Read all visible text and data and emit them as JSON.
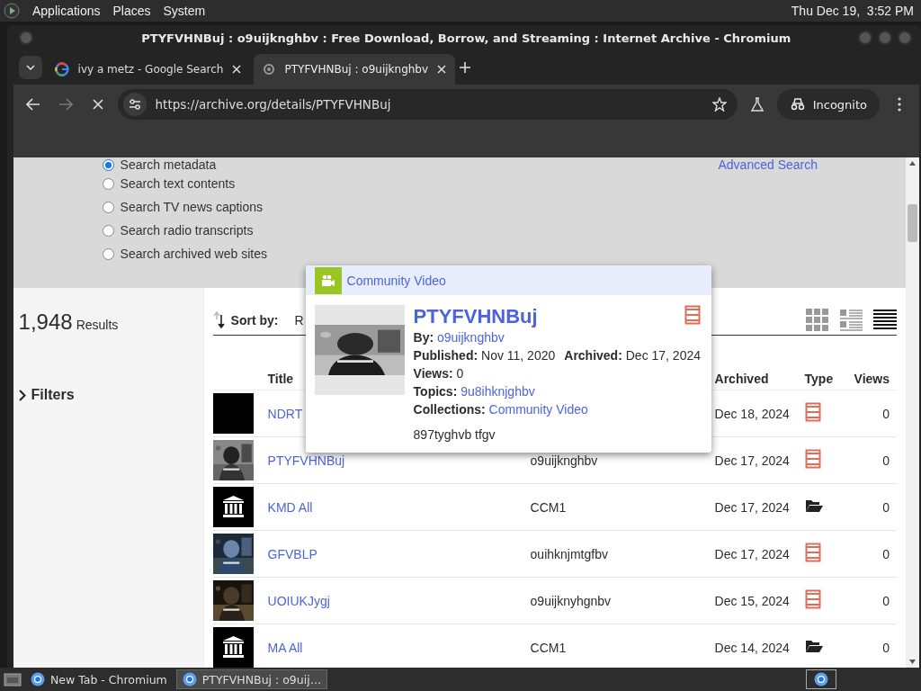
{
  "top_panel": {
    "menus": [
      "Applications",
      "Places",
      "System"
    ],
    "clock": "Thu Dec 19,  3:52 PM"
  },
  "window": {
    "title": "PTYFVHNBuj : o9uijknghbv : Free Download, Borrow, and Streaming : Internet Archive - Chromium"
  },
  "tabs": [
    {
      "label": "ivy a metz - Google Search",
      "selected": false
    },
    {
      "label": "PTYFVHNBuj : o9uijknghbv",
      "selected": true
    }
  ],
  "toolbar": {
    "forward_disabled": true,
    "url": "https://archive.org/details/PTYFVHNBuj",
    "profile": "Incognito"
  },
  "search_options": [
    {
      "label": "Search metadata",
      "selected": true
    },
    {
      "label": "Search text contents",
      "selected": false
    },
    {
      "label": "Search TV news captions",
      "selected": false
    },
    {
      "label": "Search radio transcripts",
      "selected": false
    },
    {
      "label": "Search archived web sites",
      "selected": false
    }
  ],
  "advanced_search": "Advanced Search",
  "results": {
    "count": "1,948",
    "label": "Results"
  },
  "filters": "Filters",
  "sort": {
    "label": "Sort by:",
    "value": "R"
  },
  "view_modes": [
    {
      "kind": "tiles",
      "selected": false
    },
    {
      "kind": "list",
      "selected": false
    },
    {
      "kind": "compact",
      "selected": true
    }
  ],
  "table": {
    "columns": [
      "Title",
      "Archived",
      "Type",
      "Views"
    ],
    "rows": [
      {
        "thumbnail": {
          "kind": "blank"
        },
        "title": "NDRT",
        "archived": "Dec 18, 2024",
        "kind": "movies",
        "views": "0"
      },
      {
        "title": "PTYFVHNBuj",
        "creator": "o9uijknghbv",
        "archived": "Dec 17, 2024",
        "kind": "movies",
        "views": "0"
      },
      {
        "thumbnail": {
          "kind": "collection"
        },
        "title": "KMD All",
        "creator": "CCM1",
        "archived": "Dec 17, 2024",
        "kind": "collection",
        "views": "0"
      },
      {
        "title": "GFVBLP",
        "creator": "ouihknjmtgfbv",
        "archived": "Dec 17, 2024",
        "kind": "movies",
        "views": "0"
      },
      {
        "title": "UOIUKJygj",
        "creator": "o9uijknyhgnbv",
        "archived": "Dec 15, 2024",
        "kind": "movies",
        "views": "0"
      },
      {
        "thumbnail": {
          "kind": "collection"
        },
        "title": "MA All",
        "creator": "CCM1",
        "archived": "Dec 14, 2024",
        "kind": "collection",
        "views": "0"
      }
    ]
  },
  "popup": {
    "collection": "Community Video",
    "title": "PTYFVHNBuj",
    "kind": "movies",
    "lines": [
      [
        {
          "label": "By:",
          "value": "o9uijknghbv",
          "link": true
        }
      ],
      [
        {
          "label": "Published:",
          "value": "Nov 11, 2020",
          "link": false
        },
        {
          "label": "Archived:",
          "value": "Dec 17, 2024",
          "link": false
        }
      ],
      [
        {
          "label": "Views:",
          "value": "0",
          "link": false
        }
      ],
      [
        {
          "label": "Topics:",
          "value": "9u8ihknjghbv",
          "link": true
        }
      ],
      [
        {
          "label": "Collections:",
          "value": "Community Video",
          "link": true
        }
      ]
    ],
    "description": "897tyghvb tfgv"
  },
  "taskbar": {
    "items": [
      {
        "label": "New Tab - Chromium",
        "selected": false
      },
      {
        "label": "PTYFVHNBuj : o9uij…",
        "selected": true
      }
    ]
  }
}
